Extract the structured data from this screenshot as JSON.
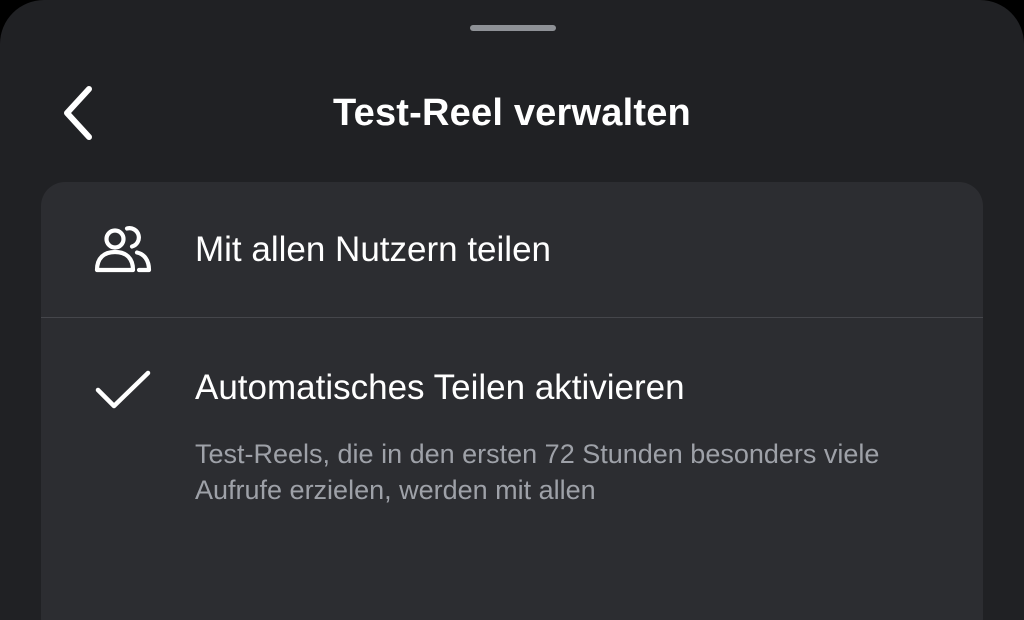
{
  "header": {
    "title": "Test-Reel verwalten",
    "back_icon": "chevron-left-icon"
  },
  "options": {
    "share_all": {
      "label": "Mit allen Nutzern teilen",
      "icon": "users-icon"
    },
    "auto_share": {
      "label": "Automatisches Teilen aktivieren",
      "icon": "checkmark-icon",
      "checked": true,
      "description": "Test-Reels, die in den ersten 72 Stunden besonders viele Aufrufe erzielen, werden mit allen"
    }
  },
  "colors": {
    "sheet_background": "#202124",
    "card_background": "#2c2d31",
    "text_primary": "#ffffff",
    "text_secondary": "#9ea1a8",
    "divider": "#45464b"
  }
}
